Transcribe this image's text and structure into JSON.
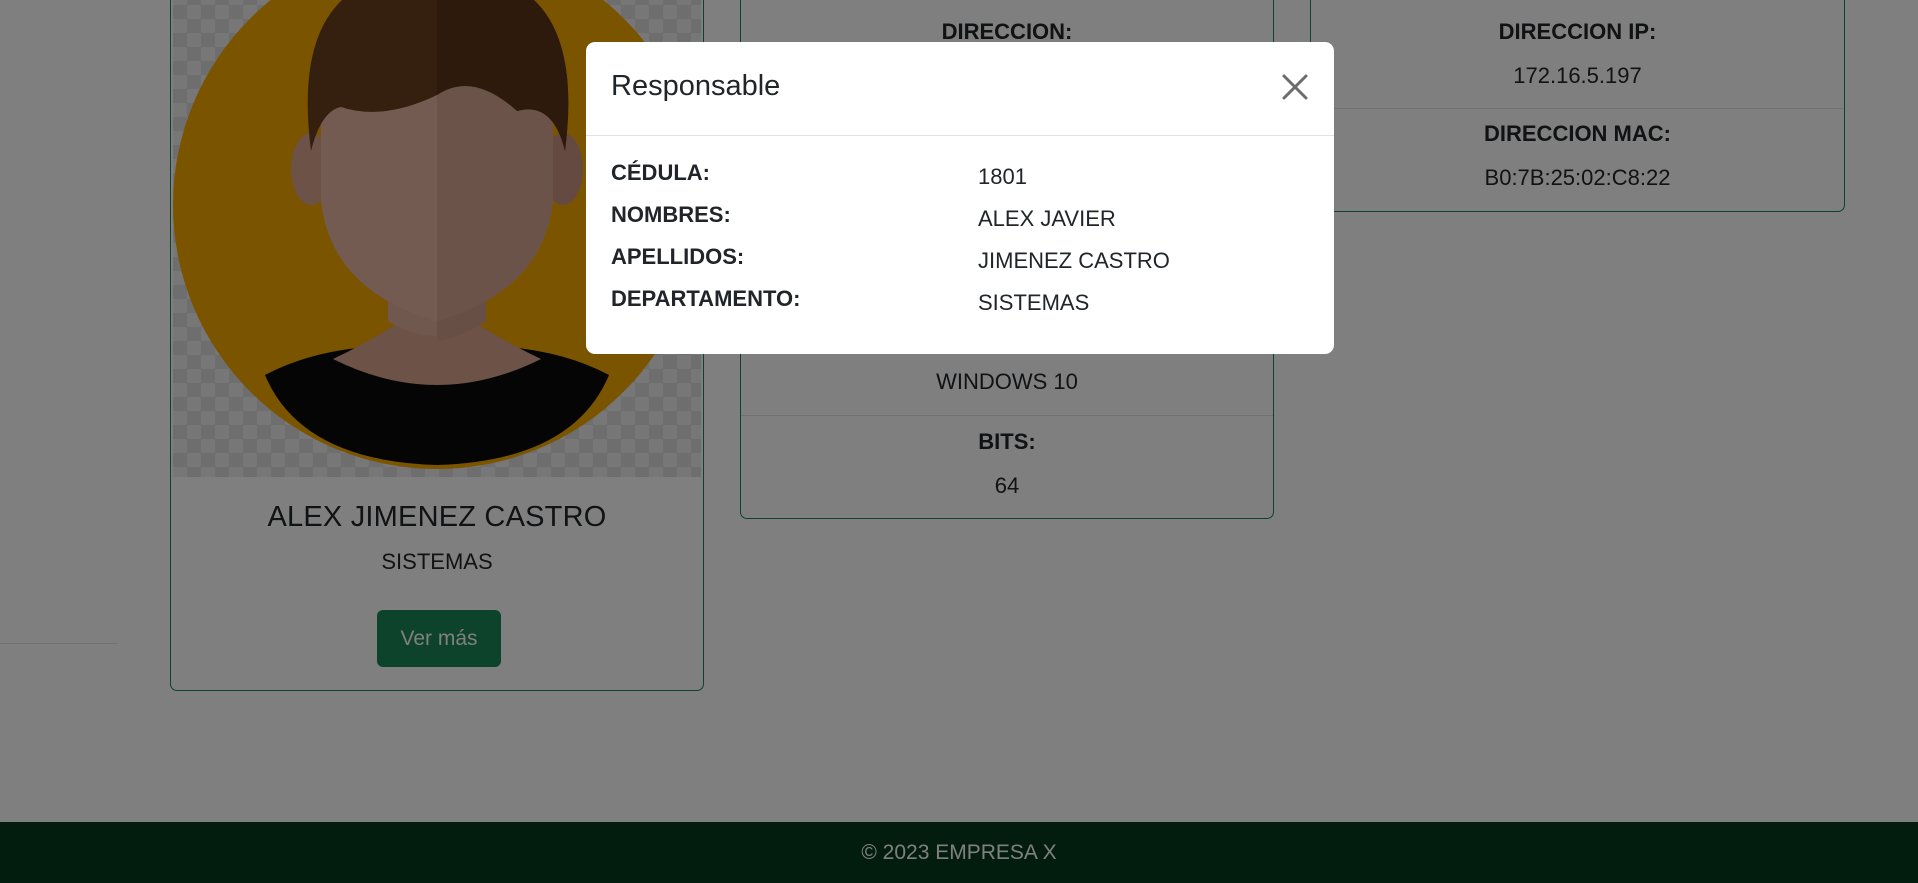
{
  "profile": {
    "name": "ALEX JIMENEZ CASTRO",
    "department": "SISTEMAS",
    "more_button_label": "Ver más"
  },
  "device_card": {
    "sections": [
      {
        "label": "DIRECCION:",
        "value": ""
      },
      {
        "label": "",
        "value": "WINDOWS 10"
      },
      {
        "label": "BITS:",
        "value": "64"
      }
    ]
  },
  "network_card": {
    "sections": [
      {
        "label": "DIRECCION IP:",
        "value": "172.16.5.197"
      },
      {
        "label": "DIRECCION MAC:",
        "value": "B0:7B:25:02:C8:22"
      }
    ]
  },
  "modal": {
    "title": "Responsable",
    "close_icon": "close-icon",
    "fields": [
      {
        "label": "CÉDULA:",
        "value": "1801"
      },
      {
        "label": "NOMBRES:",
        "value": "ALEX JAVIER"
      },
      {
        "label": "APELLIDOS:",
        "value": "JIMENEZ CASTRO"
      },
      {
        "label": "DEPARTAMENTO:",
        "value": "SISTEMAS"
      }
    ]
  },
  "footer": {
    "text": "© 2023 EMPRESA X"
  },
  "colors": {
    "accent": "#198754",
    "footer_bg": "#053b1a",
    "backdrop": "rgba(0,0,0,0.5)"
  }
}
